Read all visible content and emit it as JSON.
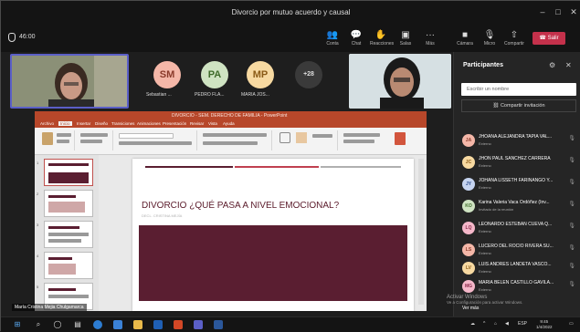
{
  "window": {
    "title": "Divorcio por mutuo acuerdo y causal",
    "controls": [
      "–",
      "□",
      "✕"
    ]
  },
  "toolbar": {
    "timer": "46:00",
    "items": [
      {
        "icon": "people-icon",
        "glyph": "👥",
        "label": "Conta"
      },
      {
        "icon": "chat-icon",
        "glyph": "💬",
        "label": "Chat"
      },
      {
        "icon": "reactions-icon",
        "glyph": "✋",
        "label": "Reacciones"
      },
      {
        "icon": "rooms-icon",
        "glyph": "▣",
        "label": "Salas"
      },
      {
        "icon": "more-icon",
        "glyph": "···",
        "label": "Más"
      },
      {
        "icon": "camera-icon",
        "glyph": "■",
        "label": "Cámara"
      },
      {
        "icon": "mic-icon",
        "glyph": "🎙",
        "label": "Micro"
      },
      {
        "icon": "share-icon",
        "glyph": "⇧",
        "label": "Compartir"
      }
    ],
    "leave_label": "Salir",
    "accent": "#c4314b"
  },
  "stage": {
    "avatars": [
      {
        "initials": "SM",
        "name": "Sebastian ...",
        "color": "#f4b7a8",
        "text": "#8a3a2a"
      },
      {
        "initials": "PA",
        "name": "PEDRO FLA...",
        "color": "#cfe3c2",
        "text": "#3f6b2b"
      },
      {
        "initials": "MP",
        "name": "MARIA JOS...",
        "color": "#f7d9a1",
        "text": "#8a5a16"
      }
    ],
    "overflow": "+28",
    "presenter_name": "María Cristina Mejia Chulgamarca"
  },
  "powerpoint": {
    "title": "DIVORCIO - SEM. DERECHO DE FAMILIA - PowerPoint",
    "tabs": [
      "Archivo",
      "Inicio",
      "Insertar",
      "Diseño",
      "Transiciones",
      "Animaciones",
      "Presentación",
      "Revisar",
      "Vista",
      "Ayuda"
    ],
    "slide_title": "DIVORCIO ¿QUÉ PASA A NIVEL EMOCIONAL?",
    "slide_subtitle": "DECL. CRISTINA MEJÍA",
    "accent": "#b7472a",
    "slide_box_color": "#5a1e31",
    "thumbnails": [
      "1",
      "2",
      "3",
      "4",
      "5"
    ]
  },
  "panel": {
    "title": "Participantes",
    "search_placeholder": "Escribir un nombre",
    "share_label": "Compartir invitación",
    "participants": [
      {
        "initials": "JA",
        "name": "JHOANA ALEJANDRA TAPIA VAL...",
        "role": "Externo",
        "color": "#f4b7a8",
        "text": "#8a3a2a"
      },
      {
        "initials": "JC",
        "name": "JHON PAUL SANCHEZ CARRERA",
        "role": "Externo",
        "color": "#f7d9a1",
        "text": "#8a5a16"
      },
      {
        "initials": "JY",
        "name": "JOHANA LISSETH FARINANGO Y...",
        "role": "Externo",
        "color": "#c6d4f0",
        "text": "#2b4a8a"
      },
      {
        "initials": "KO",
        "name": "Karina Valeria Vaca Ordóñez (Inv...",
        "role": "Invitado de la reunión",
        "color": "#cfe3c2",
        "text": "#3f6b2b"
      },
      {
        "initials": "LQ",
        "name": "LEONARDO ESTEBAN CUEVA Q...",
        "role": "Externo",
        "color": "#f4b7c9",
        "text": "#8a2a4a"
      },
      {
        "initials": "LS",
        "name": "LUCERO DEL ROCIO RIVERA SU...",
        "role": "Externo",
        "color": "#f4b7a8",
        "text": "#8a3a2a"
      },
      {
        "initials": "LV",
        "name": "LUIS ANDRES LANDETA VASCO...",
        "role": "Externo",
        "color": "#f7d9a1",
        "text": "#8a5a16"
      },
      {
        "initials": "MG",
        "name": "MARIA BELEN CASTILLO GAVILA...",
        "role": "Externo",
        "color": "#f4b7c9",
        "text": "#8a2a4a"
      }
    ],
    "see_more": "Ver más",
    "watermark_title": "Activar Windows",
    "watermark_sub": "Ve a Configuración para activar Windows."
  },
  "taskbar": {
    "language": "ESP",
    "time": "9:45",
    "date": "1/4/2022"
  }
}
